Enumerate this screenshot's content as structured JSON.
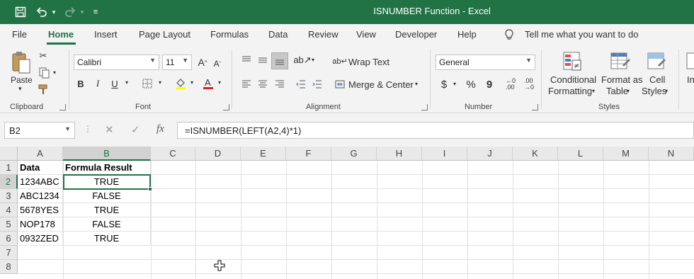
{
  "window": {
    "title": "ISNUMBER Function  -  Excel",
    "accent": "#217346"
  },
  "quick_access": {
    "save_icon": "save-icon",
    "undo_icon": "undo-icon",
    "redo_icon": "redo-icon",
    "customize_icon": "customize-toolbar-icon"
  },
  "ribbon_tabs": [
    "File",
    "Home",
    "Insert",
    "Page Layout",
    "Formulas",
    "Data",
    "Review",
    "View",
    "Developer",
    "Help"
  ],
  "active_tab": "Home",
  "tell_me": "Tell me what you want to do",
  "clipboard": {
    "paste_label": "Paste",
    "group_label": "Clipboard"
  },
  "font": {
    "name": "Calibri",
    "size": "11",
    "bold": "B",
    "italic": "I",
    "underline": "U",
    "group_label": "Font"
  },
  "alignment": {
    "wrap_text": "Wrap Text",
    "merge_center": "Merge & Center",
    "group_label": "Alignment"
  },
  "number": {
    "format": "General",
    "currency": "$",
    "percent": "%",
    "comma": "9",
    "group_label": "Number"
  },
  "styles": {
    "conditional_line1": "Conditional",
    "conditional_line2": "Formatting",
    "format_table_line1": "Format as",
    "format_table_line2": "Table",
    "cell_styles_line1": "Cell",
    "cell_styles_line2": "Styles",
    "group_label": "Styles"
  },
  "insert_partial": "In",
  "formula_bar": {
    "name_box": "B2",
    "fx": "fx",
    "formula": "=ISNUMBER(LEFT(A2,4)*1)"
  },
  "columns": [
    "A",
    "B",
    "C",
    "D",
    "E",
    "F",
    "G",
    "H",
    "I",
    "J",
    "K",
    "L",
    "M",
    "N"
  ],
  "rows": [
    "1",
    "2",
    "3",
    "4",
    "5",
    "6",
    "7",
    "8"
  ],
  "sheet": {
    "header": [
      "Data",
      "Formula Result"
    ],
    "data": [
      [
        "1234ABC",
        "TRUE"
      ],
      [
        "ABC1234",
        "FALSE"
      ],
      [
        "5678YES",
        "TRUE"
      ],
      [
        "NOP178",
        "FALSE"
      ],
      [
        "0932ZED",
        "TRUE"
      ]
    ]
  }
}
